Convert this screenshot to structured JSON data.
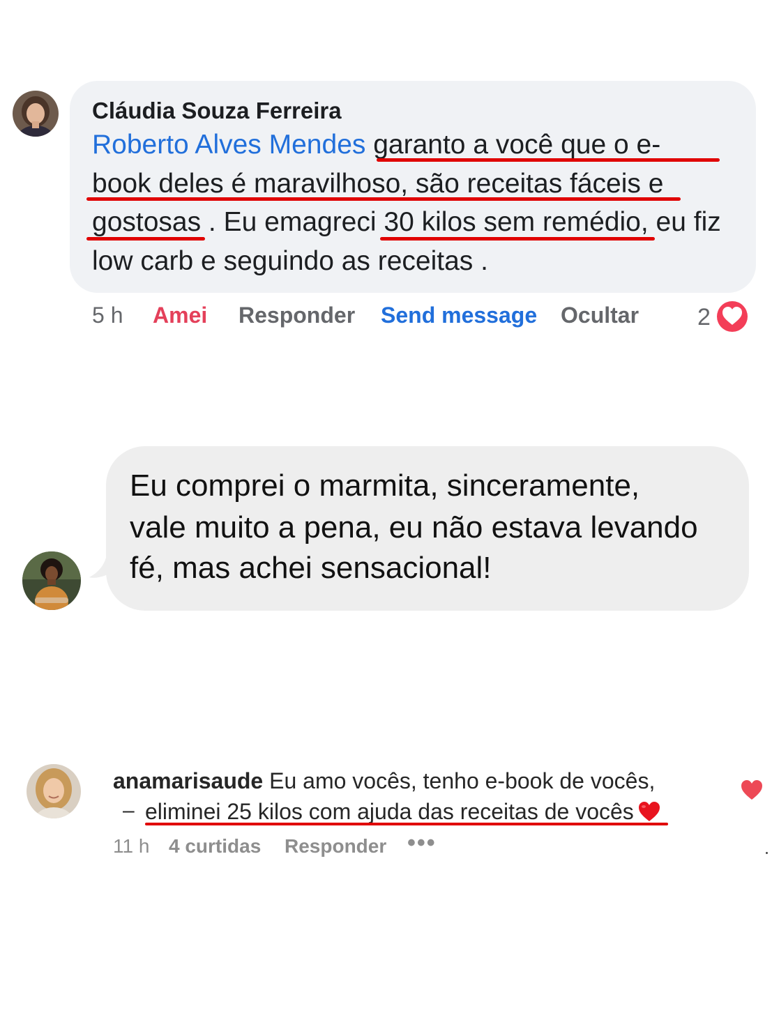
{
  "comment1": {
    "author": "Cláudia Souza Ferreira",
    "mention": "Roberto Alves Mendes",
    "line1_text": " garanto a você que o e-",
    "line2_text": "book deles é maravilhoso, são receitas fáceis e",
    "line3_text": "gostosas . Eu emagreci 30 kilos sem remédio, eu fiz",
    "line4_text": "low carb e seguindo as receitas .",
    "time": "5 h",
    "reaction_label": "Amei",
    "reply_label": "Responder",
    "send_message_label": "Send message",
    "hide_label": "Ocultar",
    "reaction_count": "2",
    "reaction_icon": "heart-reaction-icon",
    "colors": {
      "mention": "#216fdb",
      "love": "#e4405a",
      "underline": "#e00000",
      "bubble": "#f0f2f5"
    }
  },
  "comment2": {
    "line1": "Eu comprei o marmita, sinceramente,",
    "line2": "vale muito a pena, eu não estava levando",
    "line3": "fé, mas achei sensacional!",
    "colors": {
      "bubble": "#eeeeee"
    }
  },
  "comment3": {
    "username": "anamarisaude",
    "line1_text": " Eu amo vocês, tenho e-book de vocês,",
    "dash": "–",
    "line2_text": "eliminei 25 kilos com ajuda das receitas de vocês",
    "emoji_icon": "red-heart-emoji-icon",
    "time": "11 h",
    "likes": "4 curtidas",
    "reply_label": "Responder",
    "more_label": "•••",
    "like_icon": "heart-like-icon",
    "colors": {
      "heart": "#ed4956"
    }
  }
}
